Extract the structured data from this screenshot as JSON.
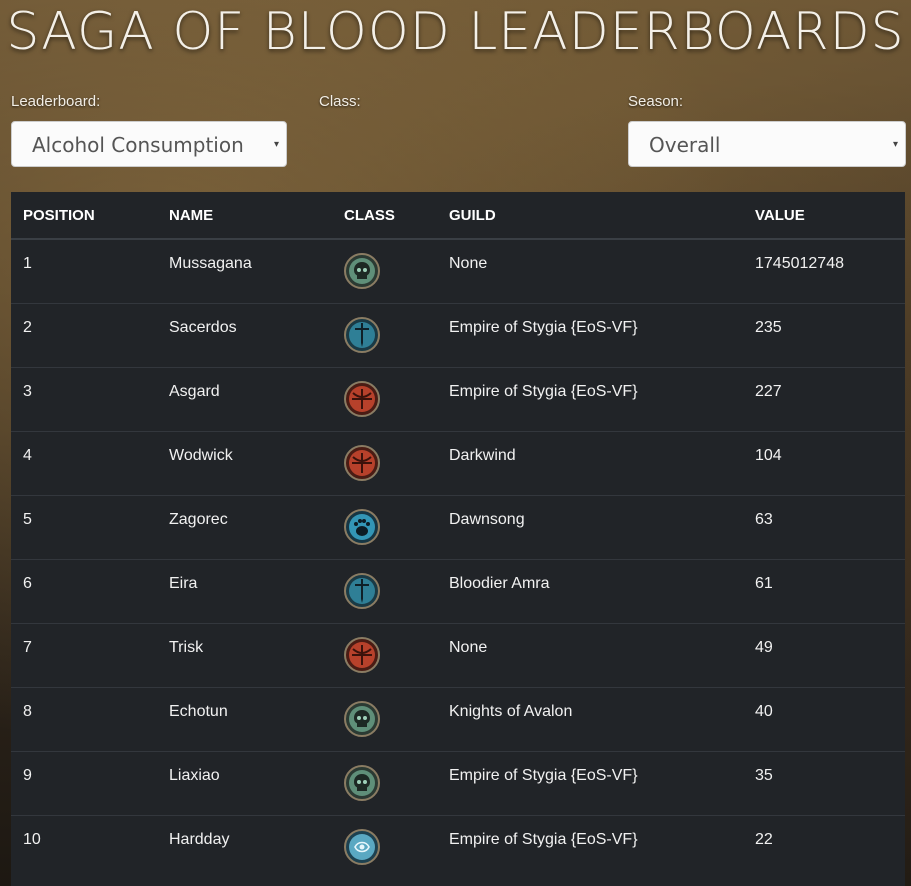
{
  "page": {
    "title": "SAGA OF BLOOD LEADERBOARDS"
  },
  "filters": {
    "leaderboard": {
      "label": "Leaderboard:",
      "value": "Alcohol Consumption"
    },
    "class": {
      "label": "Class:"
    },
    "season": {
      "label": "Season:",
      "value": "Overall"
    },
    "caret": "▾"
  },
  "table": {
    "headers": [
      "POSITION",
      "NAME",
      "CLASS",
      "GUILD",
      "VALUE"
    ],
    "rows": [
      {
        "position": "1",
        "name": "Mussagana",
        "class_icon": "skull-class-icon",
        "guild": "None",
        "value": "1745012748"
      },
      {
        "position": "2",
        "name": "Sacerdos",
        "class_icon": "sword-class-icon",
        "guild": "Empire of Stygia {EoS-VF}",
        "value": "235"
      },
      {
        "position": "3",
        "name": "Asgard",
        "class_icon": "crossbow-class-icon",
        "guild": "Empire of Stygia {EoS-VF}",
        "value": "227"
      },
      {
        "position": "4",
        "name": "Wodwick",
        "class_icon": "crossbow-class-icon",
        "guild": "Darkwind",
        "value": "104"
      },
      {
        "position": "5",
        "name": "Zagorec",
        "class_icon": "paw-class-icon",
        "guild": "Dawnsong",
        "value": "63"
      },
      {
        "position": "6",
        "name": "Eira",
        "class_icon": "sword-class-icon",
        "guild": "Bloodier Amra",
        "value": "61"
      },
      {
        "position": "7",
        "name": "Trisk",
        "class_icon": "crossbow-class-icon",
        "guild": "None",
        "value": "49"
      },
      {
        "position": "8",
        "name": "Echotun",
        "class_icon": "skull-class-icon",
        "guild": "Knights of Avalon",
        "value": "40"
      },
      {
        "position": "9",
        "name": "Liaxiao",
        "class_icon": "skull-class-icon",
        "guild": "Empire of Stygia {EoS-VF}",
        "value": "35"
      },
      {
        "position": "10",
        "name": "Hardday",
        "class_icon": "rune-class-icon",
        "guild": "Empire of Stygia {EoS-VF}",
        "value": "22"
      }
    ]
  },
  "colors": {
    "table_bg": "#212428",
    "skull": "#6fa38a",
    "sword": "#3c8fa6",
    "crossbow": "#c2452e",
    "paw": "#3aa0c0",
    "rune": "#6ab0c8"
  }
}
